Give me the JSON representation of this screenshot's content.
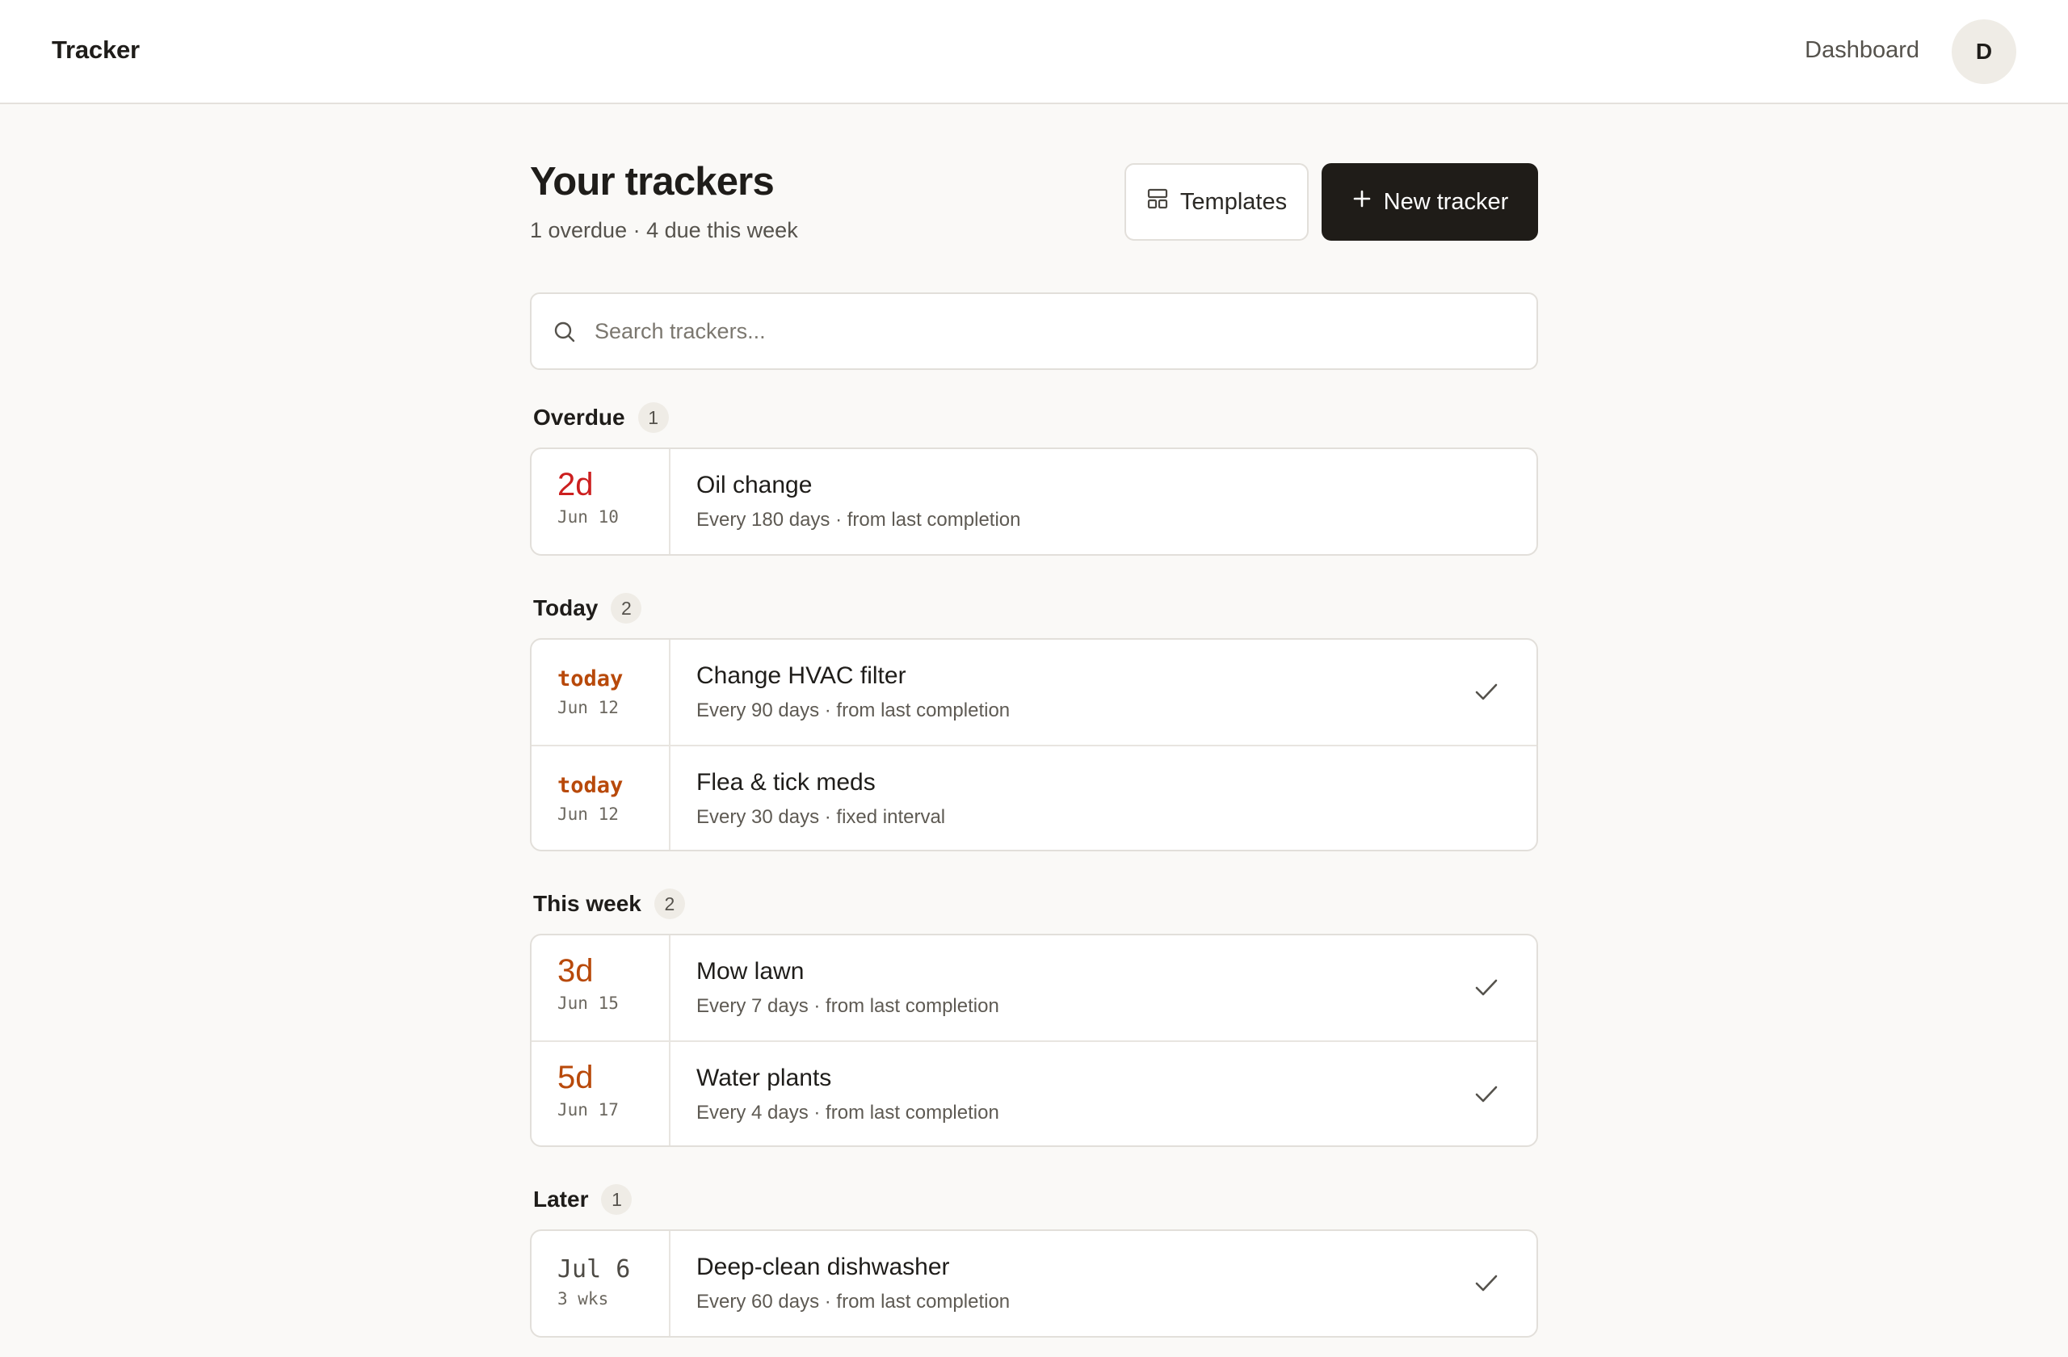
{
  "header": {
    "brand": "Tracker",
    "nav_link": "Dashboard",
    "avatar_initial": "D"
  },
  "page": {
    "title": "Your trackers",
    "subtitle": "1 overdue · 4 due this week",
    "templates_label": "Templates",
    "new_tracker_label": "New tracker"
  },
  "search": {
    "placeholder": "Search trackers...",
    "value": ""
  },
  "sections": [
    {
      "title": "Overdue",
      "count": "1",
      "items": [
        {
          "due_main": "2d",
          "due_sub": "Jun 10",
          "name": "Oil change",
          "meta": "Every 180 days · from last completion",
          "check": false
        }
      ]
    },
    {
      "title": "Today",
      "count": "2",
      "items": [
        {
          "due_main": "today",
          "due_sub": "Jun 12",
          "name": "Change HVAC filter",
          "meta": "Every 90 days · from last completion",
          "check": true
        },
        {
          "due_main": "today",
          "due_sub": "Jun 12",
          "name": "Flea & tick meds",
          "meta": "Every 30 days · fixed interval",
          "check": false
        }
      ]
    },
    {
      "title": "This week",
      "count": "2",
      "items": [
        {
          "due_main": "3d",
          "due_sub": "Jun 15",
          "name": "Mow lawn",
          "meta": "Every 7 days · from last completion",
          "check": true
        },
        {
          "due_main": "5d",
          "due_sub": "Jun 17",
          "name": "Water plants",
          "meta": "Every 4 days · from last completion",
          "check": true
        }
      ]
    },
    {
      "title": "Later",
      "count": "1",
      "items": [
        {
          "due_main": "Jul 6",
          "due_sub": "3 wks",
          "name": "Deep-clean dishwasher",
          "meta": "Every 60 days · from last completion",
          "check": true
        }
      ]
    }
  ],
  "colors": {
    "overdue": "#cc1f1f",
    "due_soon": "#b8490a",
    "primary_button": "#1f1c18"
  },
  "icons": {
    "templates": "layout-grid-icon",
    "new": "plus-icon",
    "search": "search-icon",
    "complete": "check-icon"
  }
}
